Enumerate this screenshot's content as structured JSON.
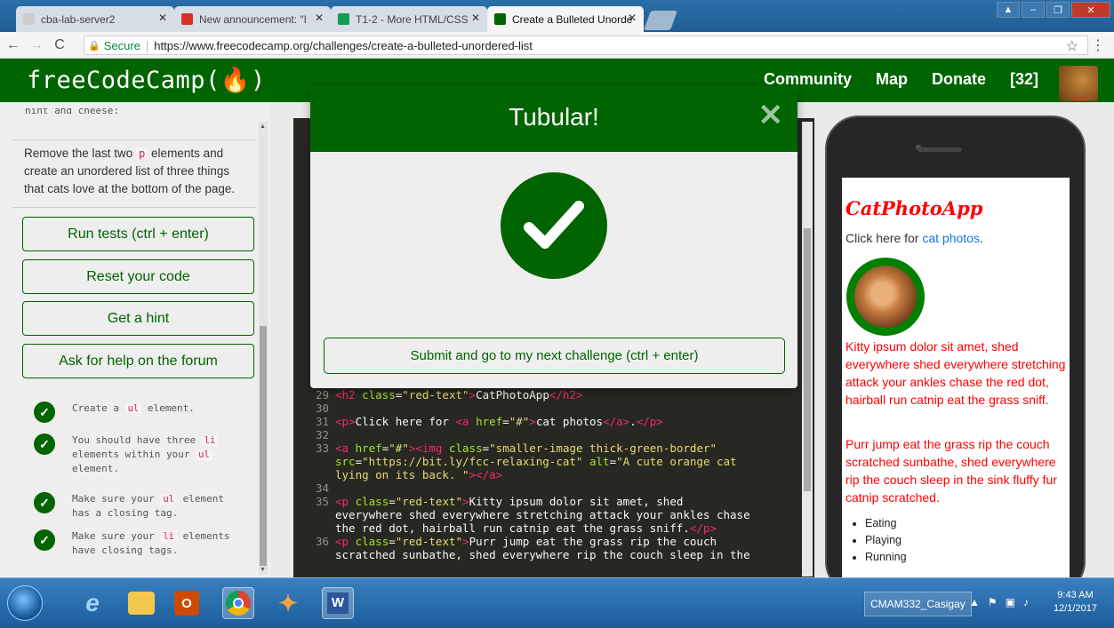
{
  "browser": {
    "tabs": [
      {
        "title": "cba-lab-server2",
        "fav_color": "#cccccc"
      },
      {
        "title": "New announcement: \"I",
        "fav_color": "#d93025"
      },
      {
        "title": "T1-2 - More HTML/CSS",
        "fav_color": "#0f9d58"
      },
      {
        "title": "Create a Bulleted Unorde",
        "fav_color": "#006400"
      }
    ],
    "secure_label": "Secure",
    "url": "https://www.freecodecamp.org/challenges/create-a-bulleted-unordered-list"
  },
  "fcc": {
    "logo": "freeCodeCamp(🔥)",
    "nav": {
      "community": "Community",
      "map": "Map",
      "donate": "Donate",
      "points": "[32]"
    }
  },
  "left_panel": {
    "cutoff_text": "hint and cheese:",
    "instruction_pre": "Remove the last two ",
    "instruction_code": "p",
    "instruction_post": " elements and create an unordered list of three things that cats love at the bottom of the page.",
    "buttons": {
      "run": "Run tests (ctrl + enter)",
      "reset": "Reset your code",
      "hint": "Get a hint",
      "help": "Ask for help on the forum"
    },
    "tests": [
      {
        "pre": "Create a ",
        "code": "ul",
        "post": " element."
      },
      {
        "pre": "You should have three ",
        "code": "li",
        "post": " elements within your ",
        "code2": "ul",
        "post2": " element."
      },
      {
        "pre": "Make sure your ",
        "code": "ul",
        "post": " element has a closing tag."
      },
      {
        "pre": "Make sure your ",
        "code": "li",
        "post": " elements have closing tags."
      }
    ]
  },
  "editor": {
    "lines": [
      {
        "n": "29",
        "html": "<span class=\"t\">&lt;h2</span> <span class=\"a\">class</span>=<span class=\"s\">\"red-text\"</span><span class=\"t\">&gt;</span>CatPhotoApp<span class=\"t\">&lt;/h2&gt;</span>"
      },
      {
        "n": "30",
        "html": ""
      },
      {
        "n": "31",
        "html": "<span class=\"t\">&lt;p&gt;</span>Click here for <span class=\"t\">&lt;a</span> <span class=\"a\">href</span>=<span class=\"s\">\"#\"</span><span class=\"t\">&gt;</span>cat photos<span class=\"t\">&lt;/a&gt;</span>.<span class=\"t\">&lt;/p&gt;</span>"
      },
      {
        "n": "32",
        "html": ""
      },
      {
        "n": "33",
        "html": "<span class=\"t\">&lt;a</span> <span class=\"a\">href</span>=<span class=\"s\">\"#\"</span><span class=\"t\">&gt;&lt;img</span> <span class=\"a\">class</span>=<span class=\"s\">\"smaller-image thick-green-border\"</span>"
      },
      {
        "n": "",
        "html": "<span class=\"a\">src</span>=<span class=\"s\">\"https://bit.ly/fcc-relaxing-cat\"</span> <span class=\"a\">alt</span>=<span class=\"s\">\"A cute orange cat</span>"
      },
      {
        "n": "",
        "html": "<span class=\"s\">lying on its back. \"</span><span class=\"t\">&gt;&lt;/a&gt;</span>"
      },
      {
        "n": "34",
        "html": ""
      },
      {
        "n": "35",
        "html": "<span class=\"t\">&lt;p</span> <span class=\"a\">class</span>=<span class=\"s\">\"red-text\"</span><span class=\"t\">&gt;</span>Kitty ipsum dolor sit amet, shed"
      },
      {
        "n": "",
        "html": "everywhere shed everywhere stretching attack your ankles chase"
      },
      {
        "n": "",
        "html": "the red dot, hairball run catnip eat the grass sniff.<span class=\"t\">&lt;/p&gt;</span>"
      },
      {
        "n": "36",
        "html": "<span class=\"t\">&lt;p</span> <span class=\"a\">class</span>=<span class=\"s\">\"red-text\"</span><span class=\"t\">&gt;</span>Purr jump eat the grass rip the couch"
      },
      {
        "n": "",
        "html": "scratched sunbathe, shed everywhere rip the couch sleep in the"
      }
    ]
  },
  "preview": {
    "title": "CatPhotoApp",
    "link_pre": "Click here for ",
    "link_text": "cat photos",
    "link_post": ".",
    "para1": "Kitty ipsum dolor sit amet, shed everywhere shed everywhere stretching attack your ankles chase the red dot, hairball run catnip eat the grass sniff.",
    "para2": "Purr jump eat the grass rip the couch scratched sunbathe, shed everywhere rip the couch sleep in the sink fluffy fur catnip scratched.",
    "list": [
      "Eating",
      "Playing",
      "Running"
    ]
  },
  "modal": {
    "title": "Tubular!",
    "close_glyph": "✕",
    "submit": "Submit and go to my next challenge (ctrl + enter)"
  },
  "taskbar": {
    "user": "CMAM332_Casigay",
    "time": "9:43 AM",
    "date": "12/1/2017"
  }
}
